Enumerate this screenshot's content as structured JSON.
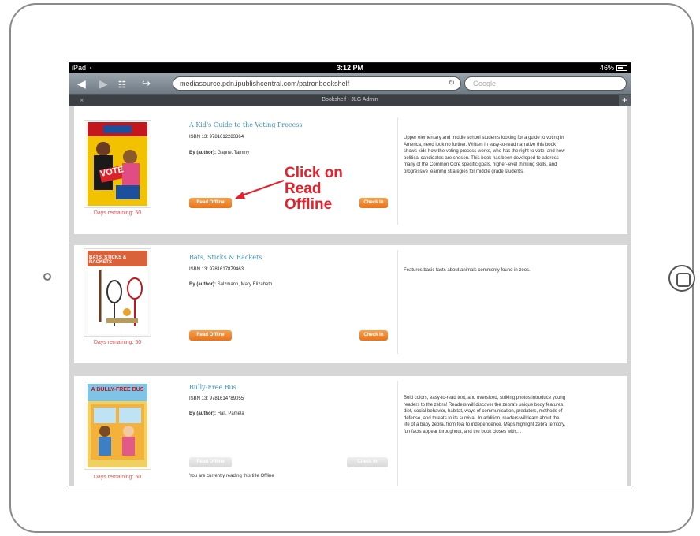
{
  "status_bar": {
    "device": "iPad",
    "time": "3:12 PM",
    "battery": "46%"
  },
  "toolbar": {
    "url": "mediasource.pdn.ipublishcentral.com/patronbookshelf",
    "search_placeholder": "Google"
  },
  "tabs": {
    "active_title": "Bookshelf - JLG Admin",
    "new_tab": "+",
    "close": "×"
  },
  "books": [
    {
      "title": "A Kid's Guide to the Voting Process",
      "isbn": "ISBN 13: 9781612283364",
      "author_label": "By (author):",
      "author": "Gagne, Tammy",
      "read_offline": "Read Offline",
      "check_in": "Check In",
      "days_remaining": "Days remaining: 50",
      "description": "Upper elementary and middle school students looking for a guide to voting in America, need look no further. Written in easy-to-read narrative this book shows kids how the voting process works, who has the right to vote, and how political candidates are chosen. This book has been developed to address many of the Common Core specific goals, higher-level thinking skills, and progressive learning strategies for middle grade students.",
      "cover_text": "VOTE"
    },
    {
      "title": "Bats, Sticks & Rackets",
      "isbn": "ISBN 13: 9781617879463",
      "author_label": "By (author):",
      "author": "Salzmann, Mary Elizabeth",
      "read_offline": "Read Offline",
      "check_in": "Check In",
      "days_remaining": "Days remaining: 50",
      "description": "Features basic facts about animals commonly found in zoos.",
      "cover_text": "BATS, STICKS & RACKETS"
    },
    {
      "title": "Bully-Free Bus",
      "isbn": "ISBN 13: 9781614789055",
      "author_label": "By (author):",
      "author": "Hall, Pamela",
      "read_offline": "Read Offline",
      "check_in": "Check In",
      "days_remaining": "Days remaining: 50",
      "description": "Bold colors, easy-to-read text, and oversized, striking photos introduce young readers to the zebra! Readers will discover the zebra's unique body features, diet, social behavior, habitat, ways of communication, predators, methods of defense, and threats to its survival. In addition, readers will learn about the life of a baby zebra, from foal to independence. Maps highlight zebra territory, fun facts appear throughout, and the book closes with....",
      "cover_text": "A BULLY-FREE BUS",
      "offline_note": "You are currently reading this title Offline"
    }
  ],
  "annotation": {
    "line1": "Click on",
    "line2": "Read",
    "line3": "Offline",
    "color": "#e8202a"
  },
  "colors": {
    "accent_orange": "#e8731b",
    "title_blue": "#3a8fb7",
    "days_red": "#d9534f"
  }
}
